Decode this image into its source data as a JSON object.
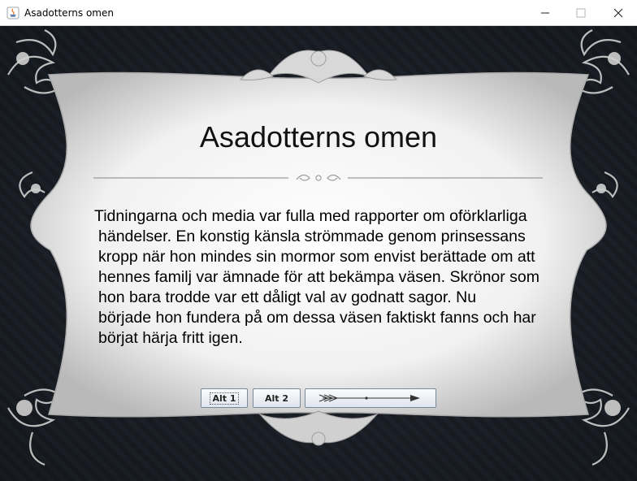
{
  "window": {
    "title": "Asadotterns omen",
    "controls": {
      "minimize": "minimize-icon",
      "maximize": "maximize-icon",
      "close": "close-icon"
    }
  },
  "scene": {
    "heading": "Asadotterns omen",
    "paragraph_lines": [
      "Tidningarna och media var fulla med rapporter om oförklarliga",
      "händelser. En konstig känsla strömmade genom prinsessans",
      "kropp när hon mindes sin mormor som envist berättade om att",
      "hennes familj var ämnade för att bekämpa väsen. Skrönor som",
      "hon bara trodde var ett dåligt val av godnatt sagor. Nu",
      "började hon fundera på om dessa väsen faktiskt fanns och har",
      "börjat härja fritt igen."
    ]
  },
  "buttons": {
    "alt1": "Alt 1",
    "alt2": "Alt 2",
    "next_icon": "arrow-right-icon"
  },
  "colors": {
    "background": "#1d2026",
    "panel": "#f2f2f2",
    "ornament": "#c9c9c9",
    "button_border": "#7a8a99"
  }
}
